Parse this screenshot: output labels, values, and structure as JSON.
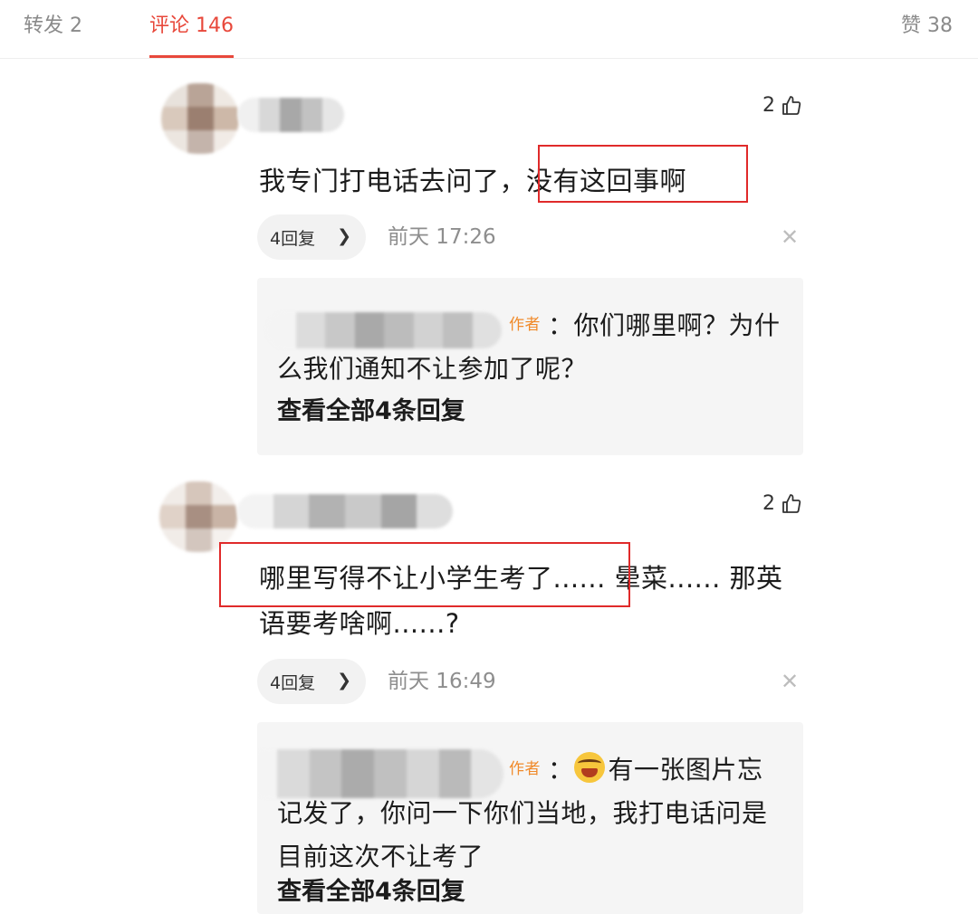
{
  "tabs": {
    "repost": "转发 2",
    "comment": "评论 146",
    "like": "赞 38"
  },
  "accent_color": "#e8483b",
  "comments": [
    {
      "likes": "2",
      "text": "我专门打电话去问了，没有这回事啊",
      "reply_count_label": "4回复",
      "time": "前天 17:26",
      "reply": {
        "author_tag": "作者",
        "text": "：你们哪里啊？为什么我们通知不让参加了呢？",
        "view_all": "查看全部4条回复"
      }
    },
    {
      "likes": "2",
      "text": "哪里写得不让小学生考了...... 晕菜...... 那英语要考啥啊......?",
      "reply_count_label": "4回复",
      "time": "前天 16:49",
      "reply": {
        "author_tag": "作者",
        "text": "有一张图片忘记发了，你问一下你们当地，我打电话问是目前这次不让考了",
        "view_all": "查看全部4条回复"
      }
    }
  ],
  "icons": {
    "like": "thumbs-up-icon",
    "chevron": "chevron-right-icon",
    "close": "close-icon",
    "emoji": "crying-laughing-emoji-icon"
  }
}
